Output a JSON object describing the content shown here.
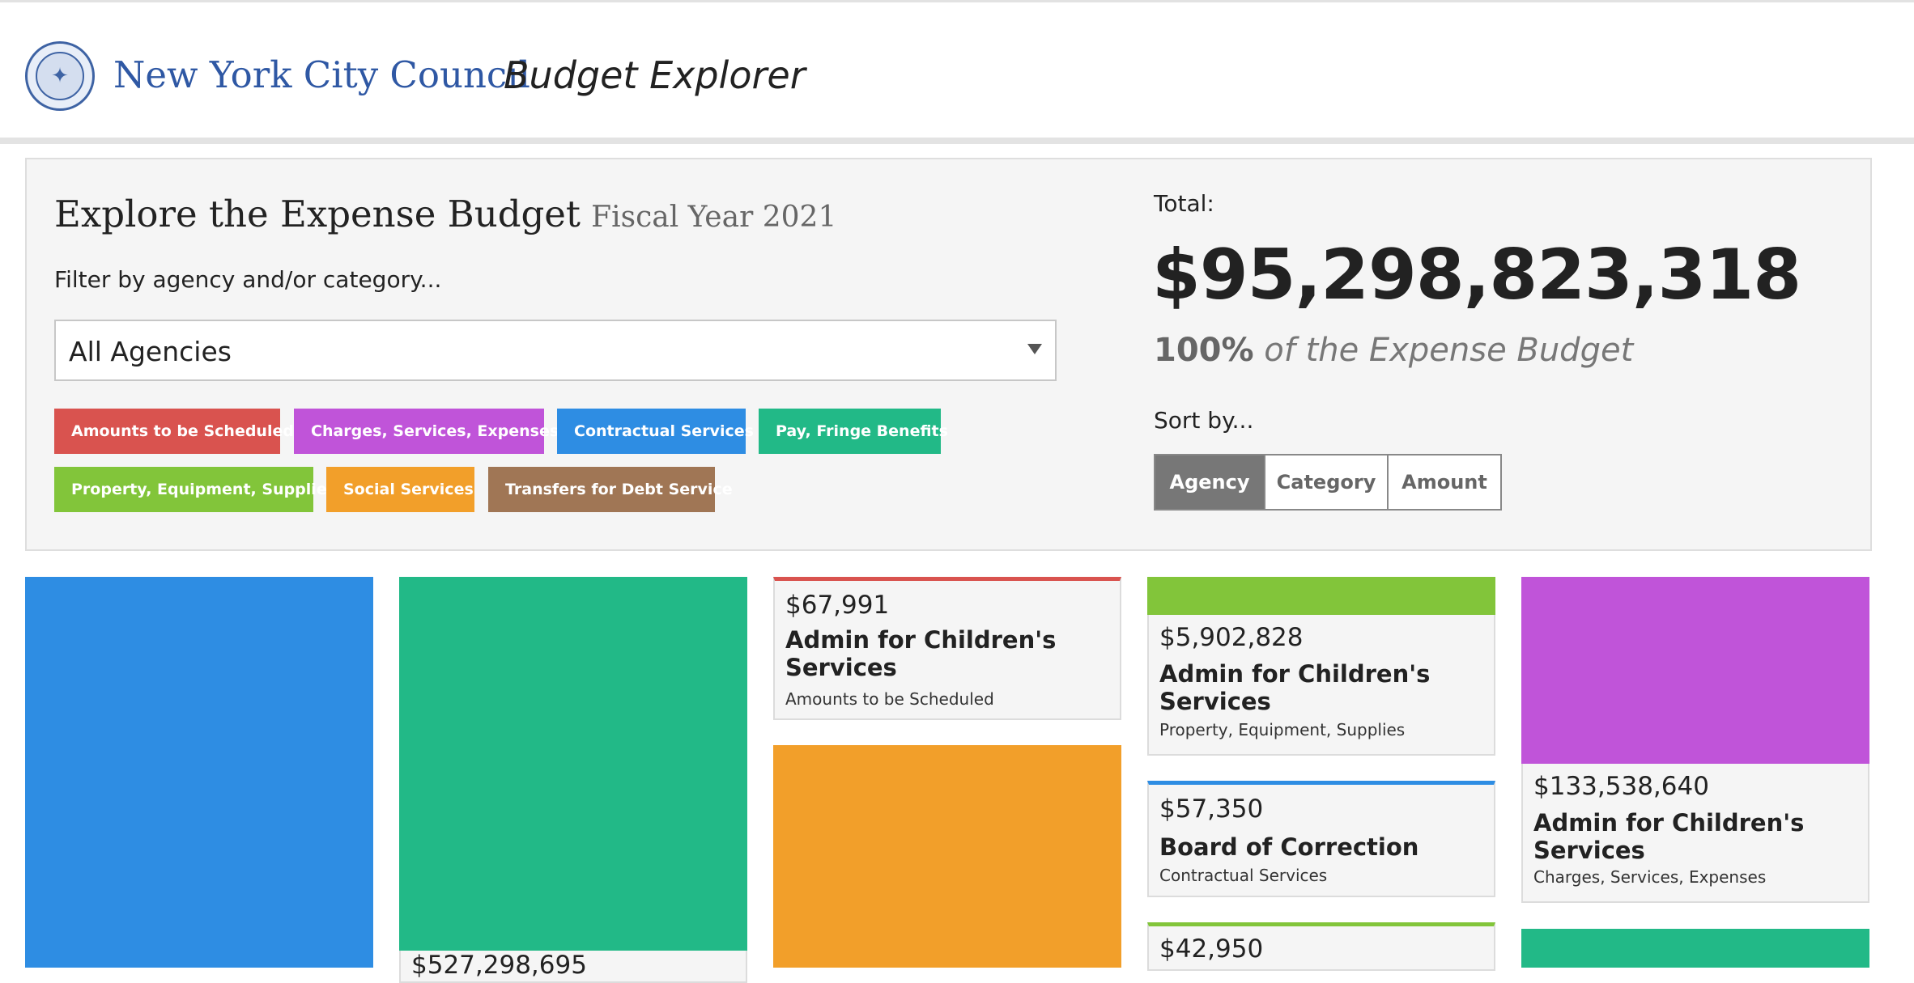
{
  "header": {
    "logo_icon": "nyc-council-seal-icon",
    "brand": "New York City Council",
    "app_name": "Budget Explorer"
  },
  "panel": {
    "title": "Explore the Expense Budget",
    "fiscal_year": "Fiscal Year 2021",
    "filter_label": "Filter by agency and/or category...",
    "agency_select": {
      "value": "All Agencies",
      "icon": "caret-down-icon"
    },
    "categories": [
      {
        "label": "Amounts to be Scheduled",
        "color": "#d9534f"
      },
      {
        "label": "Charges, Services, Expenses",
        "color": "#c054d9"
      },
      {
        "label": "Contractual Services",
        "color": "#2e8de3"
      },
      {
        "label": "Pay, Fringe Benefits",
        "color": "#22b987"
      },
      {
        "label": "Property, Equipment, Supplies",
        "color": "#82c53a"
      },
      {
        "label": "Social Services",
        "color": "#f29f2a"
      },
      {
        "label": "Transfers for Debt Service",
        "color": "#a07655"
      }
    ],
    "total_label": "Total:",
    "total_amount": "$95,298,823,318",
    "total_percent": "100%",
    "total_percent_suffix": "of the Expense Budget",
    "sort_label": "Sort by...",
    "sort_options": [
      "Agency",
      "Category",
      "Amount"
    ],
    "sort_selected": "Agency"
  },
  "cards": [
    {
      "amount": "$67,991",
      "agency": "Admin for Children's Services",
      "category": "Amounts to be Scheduled",
      "color": "#d9534f"
    },
    {
      "amount": "$5,902,828",
      "agency": "Admin for Children's Services",
      "category": "Property, Equipment, Supplies",
      "color": "#82c53a"
    },
    {
      "amount": "$57,350",
      "agency": "Board of Correction",
      "category": "Contractual Services",
      "color": "#2e8de3"
    },
    {
      "amount": "$42,950",
      "color": "#82c53a"
    },
    {
      "amount": "$133,538,640",
      "agency": "Admin for Children's Services",
      "category": "Charges, Services, Expenses",
      "color": "#c054d9"
    },
    {
      "amount": "$527,298,695",
      "color": "#22b987"
    }
  ],
  "color_blocks": {
    "contractual": "#2e8de3",
    "pay_fringe": "#22b987",
    "social": "#f29f2a",
    "property": "#82c53a",
    "charges": "#c054d9"
  }
}
